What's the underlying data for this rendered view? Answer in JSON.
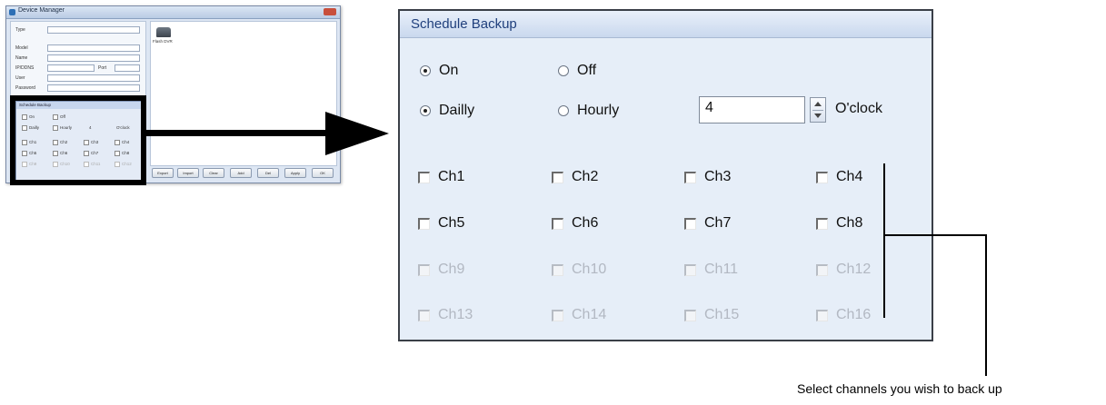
{
  "thumbnail": {
    "window_title": "Device Manager",
    "form": {
      "type_label": "Type",
      "model_label": "Model",
      "name_label": "Name",
      "ip_label": "IP/DDNS",
      "port_label": "Port",
      "user_label": "User",
      "password_label": "Password"
    },
    "device_label": "Flash DVR",
    "buttons": [
      "Export",
      "Import",
      "Clear",
      "Add",
      "Del",
      "Apply",
      "OK"
    ]
  },
  "schedule_backup": {
    "title": "Schedule Backup",
    "enable": {
      "on_label": "On",
      "off_label": "Off",
      "selected": "On"
    },
    "frequency": {
      "daily_label": "Dailly",
      "hourly_label": "Hourly",
      "selected": "Dailly"
    },
    "hour": {
      "value": "4",
      "unit_label": "O'clock"
    },
    "channels": [
      {
        "label": "Ch1",
        "checked": false,
        "enabled": true
      },
      {
        "label": "Ch2",
        "checked": false,
        "enabled": true
      },
      {
        "label": "Ch3",
        "checked": false,
        "enabled": true
      },
      {
        "label": "Ch4",
        "checked": false,
        "enabled": true
      },
      {
        "label": "Ch5",
        "checked": false,
        "enabled": true
      },
      {
        "label": "Ch6",
        "checked": false,
        "enabled": true
      },
      {
        "label": "Ch7",
        "checked": false,
        "enabled": true
      },
      {
        "label": "Ch8",
        "checked": false,
        "enabled": true
      },
      {
        "label": "Ch9",
        "checked": false,
        "enabled": false
      },
      {
        "label": "Ch10",
        "checked": false,
        "enabled": false
      },
      {
        "label": "Ch11",
        "checked": false,
        "enabled": false
      },
      {
        "label": "Ch12",
        "checked": false,
        "enabled": false
      },
      {
        "label": "Ch13",
        "checked": false,
        "enabled": false
      },
      {
        "label": "Ch14",
        "checked": false,
        "enabled": false
      },
      {
        "label": "Ch15",
        "checked": false,
        "enabled": false
      },
      {
        "label": "Ch16",
        "checked": false,
        "enabled": false
      }
    ]
  },
  "callout": {
    "caption": "Select channels you wish to back up"
  },
  "colors": {
    "panel_bg": "#e6eef8",
    "title_text": "#1f3f7c",
    "disabled_text": "#b2b8c2"
  }
}
